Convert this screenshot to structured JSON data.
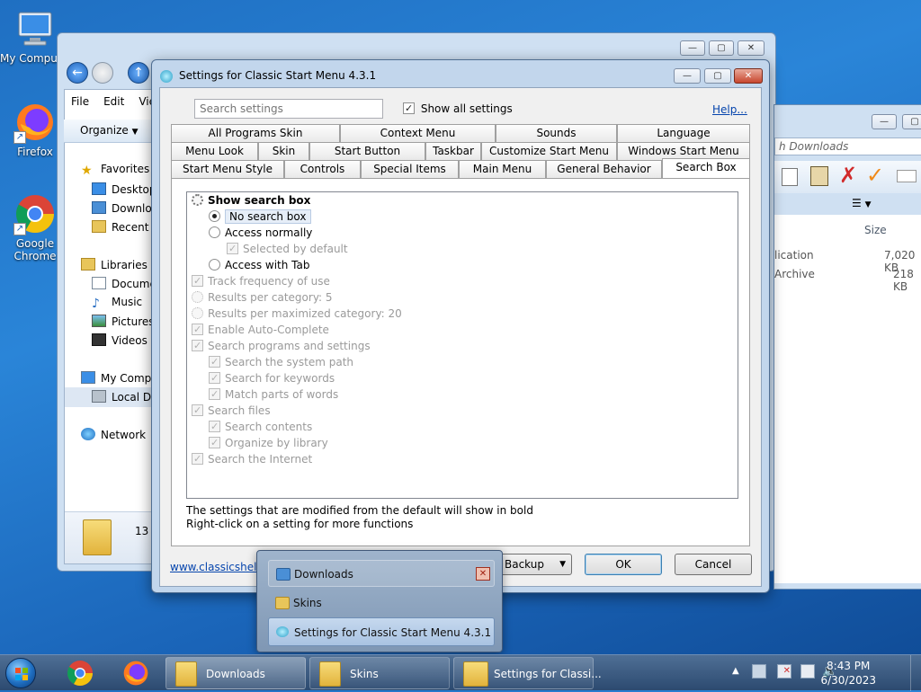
{
  "desktop": {
    "icons": [
      {
        "label": "My Computer",
        "icon": "computer-icon"
      },
      {
        "label": "Firefox",
        "icon": "firefox-icon"
      },
      {
        "label": "Google Chrome",
        "icon": "chrome-icon"
      }
    ]
  },
  "explorer": {
    "menu": [
      "File",
      "Edit",
      "View"
    ],
    "toolbar": {
      "organize": "Organize"
    },
    "nav": {
      "favorites": "Favorites",
      "desktop": "Desktop",
      "downloads": "Downloads",
      "recent": "Recent Places",
      "libraries": "Libraries",
      "documents": "Documents",
      "music": "Music",
      "pictures": "Pictures",
      "videos": "Videos",
      "computer": "My Computer",
      "local_disk": "Local Disk",
      "network": "Network"
    },
    "footer_count": "13"
  },
  "explorer2": {
    "breadcrumb": "h Downloads",
    "size_header": "Size",
    "rows": [
      {
        "type": "lication",
        "size": "7,020 KB"
      },
      {
        "type": "Archive",
        "size": "218 KB"
      }
    ]
  },
  "dialog": {
    "title": "Settings for Classic Start Menu 4.3.1",
    "search_placeholder": "Search settings",
    "show_all": "Show all settings",
    "help": "Help...",
    "tabs_row1": [
      "All Programs Skin",
      "Context Menu",
      "Sounds",
      "Language"
    ],
    "tabs_row2": [
      "Menu Look",
      "Skin",
      "Start Button",
      "Taskbar",
      "Customize Start Menu",
      "Windows Start Menu"
    ],
    "tabs_row3": [
      "Start Menu Style",
      "Controls",
      "Special Items",
      "Main Menu",
      "General Behavior",
      "Search Box"
    ],
    "settings": [
      "Show search box",
      "No search box",
      "Access normally",
      "Selected by default",
      "Access with Tab",
      "Track frequency of use",
      "Results per category: 5",
      "Results per maximized category: 20",
      "Enable Auto-Complete",
      "Search programs and settings",
      "Search the system path",
      "Search for keywords",
      "Match parts of words",
      "Search files",
      "Search contents",
      "Organize by library",
      "Search the Internet"
    ],
    "hint1": "The settings that are modified from the default will show in bold",
    "hint2": "Right-click on a setting for more functions",
    "website": "www.classicshell.net",
    "backup": "Backup",
    "ok": "OK",
    "cancel": "Cancel"
  },
  "popup": {
    "items": [
      "Downloads",
      "Skins",
      "Settings for Classic Start Menu 4.3.1"
    ]
  },
  "taskbar": {
    "buttons": [
      "Downloads",
      "Skins",
      "Settings for Classi..."
    ],
    "time": "8:43 PM",
    "date": "6/30/2023"
  }
}
